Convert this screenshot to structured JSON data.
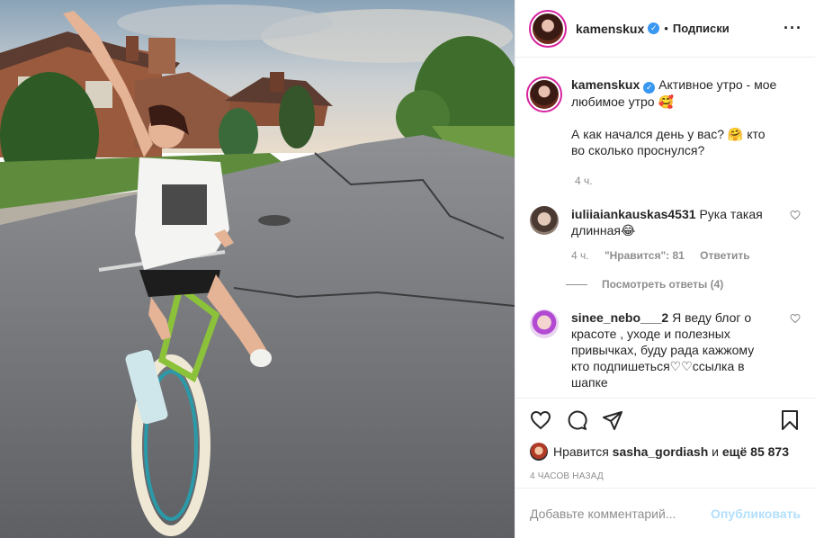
{
  "author": {
    "username": "kamenskux",
    "verified_icon": "verified-badge-icon",
    "separator": "•",
    "follow_label": "Подписки"
  },
  "caption": {
    "username": "kamenskux",
    "text_line1": "Активное утро - мое любимое утро 🥰",
    "text_line2": "А как начался день у вас? 🤗 кто во сколько проснулся?",
    "time": "4 ч."
  },
  "comments": [
    {
      "username": "iuliiaiankauskas4531",
      "text": "Рука такая длинная😂",
      "time": "4 ч.",
      "likes": "\"Нравится\": 81",
      "reply": "Ответить",
      "view_replies": "Посмотреть ответы (4)"
    },
    {
      "username": "sinee_nebo___2",
      "text": "Я веду блог о красоте , уходе и полезных привычках, буду рада кажжому кто подпишеться♡♡ссылка в шапке"
    }
  ],
  "likes": {
    "prefix": "Нравится",
    "user": "sasha_gordiash",
    "and": "и",
    "others": "ещё 85 873"
  },
  "timestamp": "4 часов назад",
  "add_comment": {
    "placeholder": "Добавьте комментарий...",
    "publish": "Опубликовать"
  },
  "colors": {
    "accent": "#3897f0",
    "publish_disabled": "#b2dffc",
    "secondary_text": "#8e8e8e",
    "border": "#efefef"
  }
}
